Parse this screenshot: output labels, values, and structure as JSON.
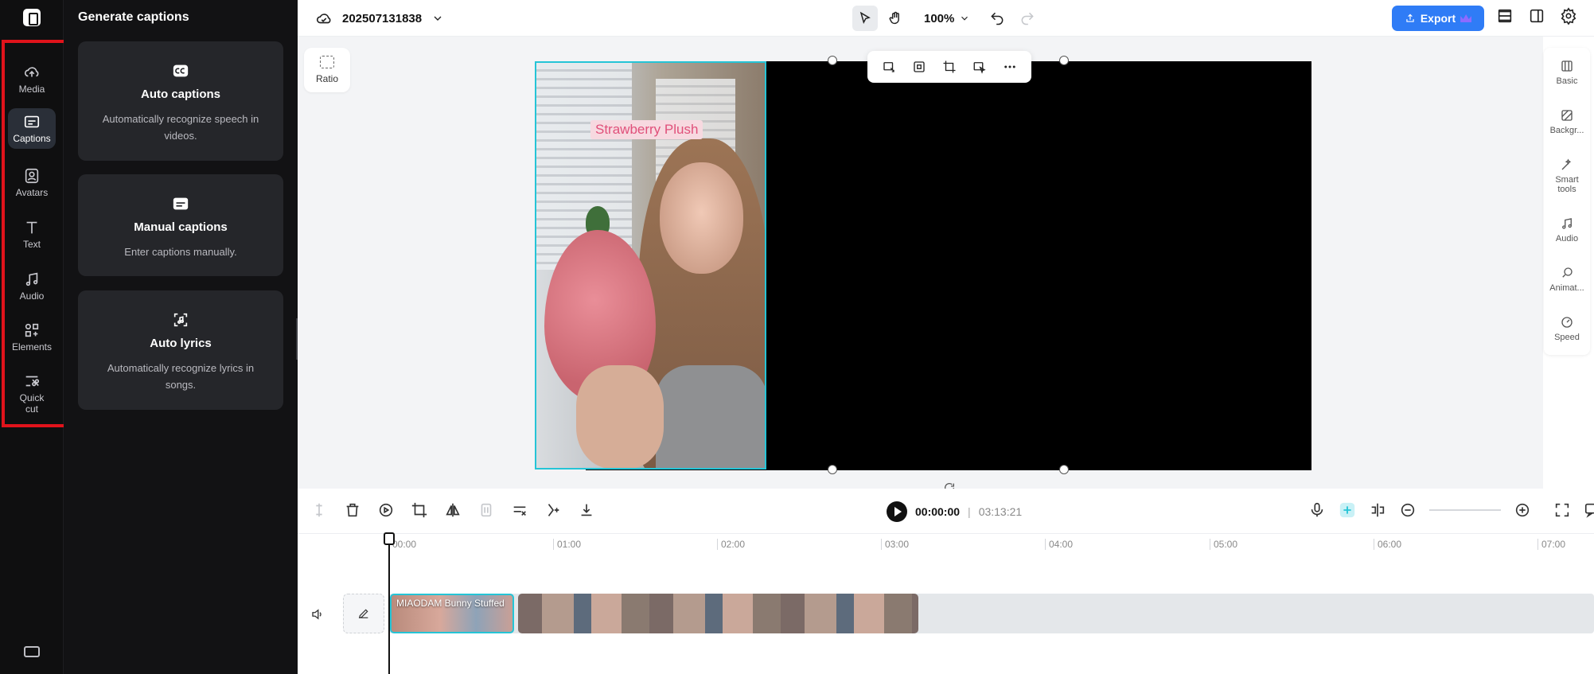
{
  "rail": {
    "items": [
      {
        "label": "Media",
        "icon": "cloud-upload-icon"
      },
      {
        "label": "Captions",
        "icon": "captions-icon"
      },
      {
        "label": "Avatars",
        "icon": "avatar-icon"
      },
      {
        "label": "Text",
        "icon": "text-icon"
      },
      {
        "label": "Audio",
        "icon": "music-note-icon"
      },
      {
        "label": "Elements",
        "icon": "elements-icon"
      },
      {
        "label": "Quick\ncut",
        "icon": "quick-cut-icon"
      }
    ],
    "active": "Captions"
  },
  "panel": {
    "title": "Generate captions",
    "cards": [
      {
        "title": "Auto captions",
        "desc": "Automatically recognize speech in videos.",
        "icon": "cc-icon"
      },
      {
        "title": "Manual captions",
        "desc": "Enter captions manually.",
        "icon": "subtitles-icon"
      },
      {
        "title": "Auto lyrics",
        "desc": "Automatically recognize lyrics in songs.",
        "icon": "lyrics-icon"
      }
    ]
  },
  "topbar": {
    "project_name": "202507131838",
    "zoom": "100%",
    "export_label": "Export"
  },
  "canvas": {
    "ratio_label": "Ratio",
    "caption_text": "Strawberry Plush"
  },
  "props": {
    "items": [
      "Basic",
      "Backgr...",
      "Smart tools",
      "Audio",
      "Animat...",
      "Speed"
    ]
  },
  "timeline": {
    "current_time": "00:00:00",
    "separator": "|",
    "total_time": "03:13:21",
    "ticks": [
      "00:00",
      "01:00",
      "02:00",
      "03:00",
      "04:00",
      "05:00",
      "06:00",
      "07:00"
    ],
    "clip_label": "MIAODAM Bunny Stuffed"
  },
  "colors": {
    "accent": "#2f7cf6",
    "selection": "#25c4d6",
    "highlight_box": "#e0131b",
    "caption_text": "#e0507a"
  }
}
